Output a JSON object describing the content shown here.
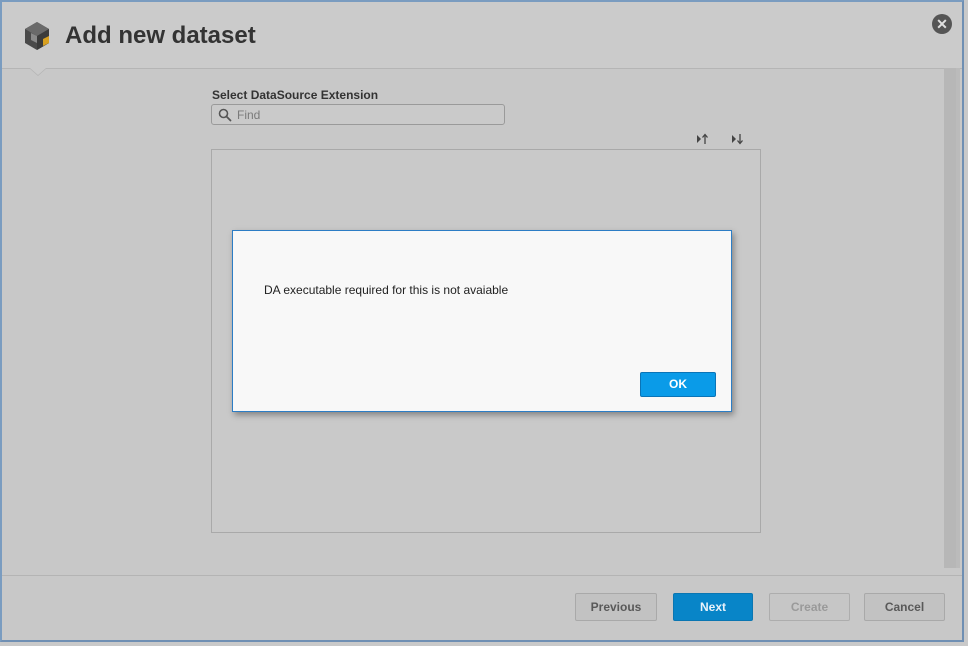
{
  "window": {
    "title": "Add new dataset",
    "close_label": "✕"
  },
  "form": {
    "label": "Select DataSource Extension",
    "search_placeholder": "Find",
    "search_value": ""
  },
  "sort": {
    "asc_label": "↑",
    "desc_label": "↓"
  },
  "dialog": {
    "message": "DA executable required for this is not avaiable",
    "ok_label": "OK"
  },
  "footer": {
    "previous_label": "Previous",
    "next_label": "Next",
    "create_label": "Create",
    "cancel_label": "Cancel"
  },
  "colors": {
    "accent": "#0885c8",
    "dialog_border": "#2c7dc5"
  }
}
